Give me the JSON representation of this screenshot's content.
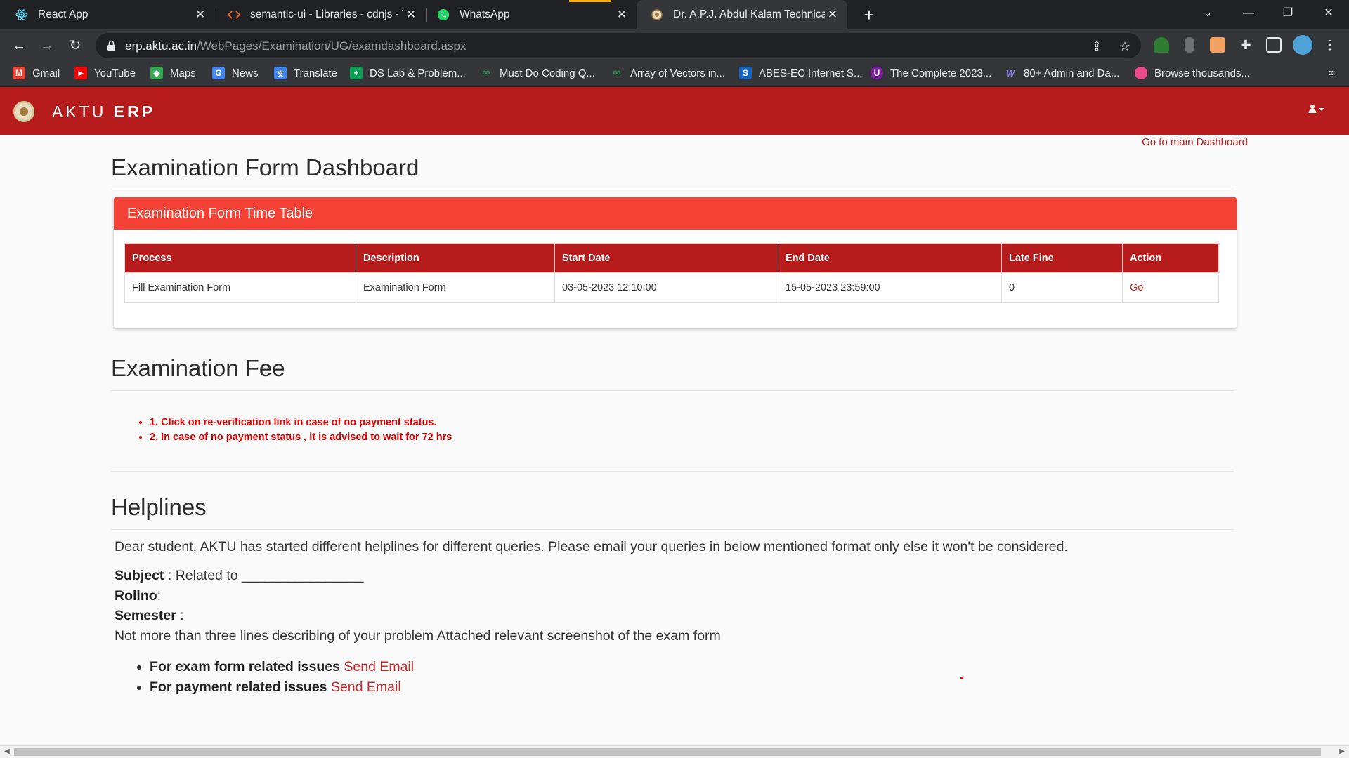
{
  "browser": {
    "tabs": [
      {
        "title": "React App",
        "icon": "react-icon",
        "active": false
      },
      {
        "title": "semantic-ui - Libraries - cdnjs - T",
        "icon": "code-icon",
        "active": false
      },
      {
        "title": "WhatsApp",
        "icon": "whatsapp-icon",
        "active": false
      },
      {
        "title": "Dr. A.P.J. Abdul Kalam Technical U",
        "icon": "aktu-icon",
        "active": true
      }
    ],
    "url_host": "erp.aktu.ac.in",
    "url_path": "/WebPages/Examination/UG/examdashboard.aspx",
    "bookmarks": [
      {
        "label": "Gmail",
        "color": "#ea4335",
        "glyph": "M"
      },
      {
        "label": "YouTube",
        "color": "#ff0000",
        "glyph": "▶"
      },
      {
        "label": "Maps",
        "color": "#34a853",
        "glyph": "◆"
      },
      {
        "label": "News",
        "color": "#4285f4",
        "glyph": "G"
      },
      {
        "label": "Translate",
        "color": "#4285f4",
        "glyph": "文"
      },
      {
        "label": "DS Lab & Problem...",
        "color": "#0f9d58",
        "glyph": "+"
      },
      {
        "label": "Must Do Coding Q...",
        "color": "#2f8d46",
        "glyph": "∞"
      },
      {
        "label": "Array of Vectors in...",
        "color": "#2f8d46",
        "glyph": "∞"
      },
      {
        "label": "ABES-EC Internet S...",
        "color": "#1565c0",
        "glyph": "S"
      },
      {
        "label": "The Complete 2023...",
        "color": "#7b1fa2",
        "glyph": "U"
      },
      {
        "label": "80+ Admin and Da...",
        "color": "#6a5acd",
        "glyph": "W"
      },
      {
        "label": "Browse thousands...",
        "color": "#ea4c89",
        "glyph": "●"
      }
    ]
  },
  "app": {
    "brand_light": "AKTU",
    "brand_bold": "ERP",
    "main_dashboard_link": "Go to main Dashboard"
  },
  "exam_form": {
    "title": "Examination Form Dashboard",
    "panel_title": "Examination Form Time Table",
    "columns": [
      "Process",
      "Description",
      "Start Date",
      "End Date",
      "Late Fine",
      "Action"
    ],
    "rows": [
      {
        "process": "Fill Examination Form",
        "description": "Examination Form",
        "start": "03-05-2023 12:10:00",
        "end": "15-05-2023 23:59:00",
        "late_fine": "0",
        "action": "Go"
      }
    ]
  },
  "fee": {
    "title": "Examination Fee",
    "notes": [
      "1. Click on re-verification link in case of no payment status.",
      "2. In case of no payment status , it is advised to wait for 72 hrs"
    ]
  },
  "helplines": {
    "title": "Helplines",
    "intro": "Dear student, AKTU has started different helplines for different queries. Please email your queries in below mentioned format only else it won't be considered.",
    "subject_label": "Subject",
    "subject_text": " : Related to ________________",
    "rollno_label": "Rollno",
    "rollno_text": ":",
    "semester_label": "Semester",
    "semester_text": " :",
    "description": "Not more than three lines describing of your problem Attached relevant screenshot of the exam form",
    "items": [
      {
        "label": "For exam form related issues",
        "link": "Send Email"
      },
      {
        "label": "For payment related issues",
        "link": "Send Email"
      }
    ]
  },
  "colors": {
    "appbar": "#b71c1c",
    "panel_header": "#f44336",
    "link": "#c62828",
    "fee_note": "#e00000"
  }
}
